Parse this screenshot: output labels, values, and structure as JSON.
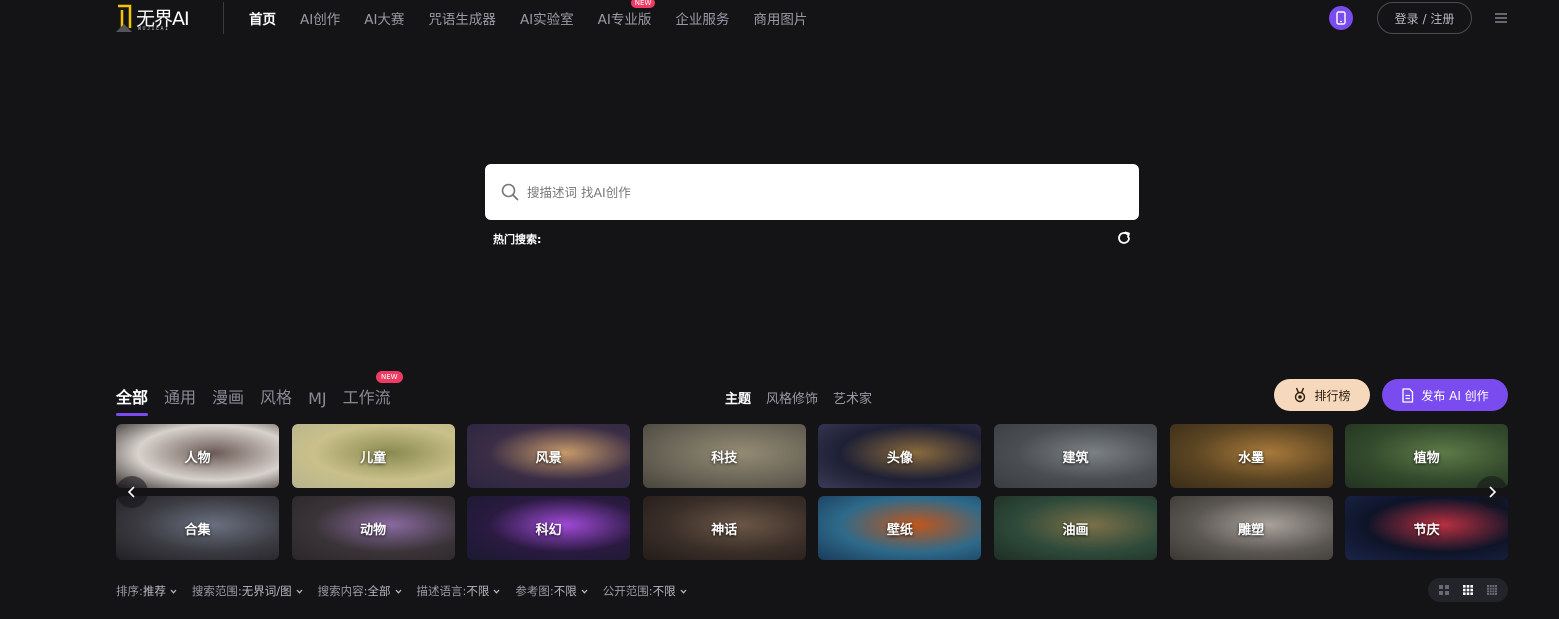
{
  "header": {
    "logo": {
      "text": "无界AI",
      "sub": "WUJIEAI"
    },
    "nav": [
      {
        "label": "首页",
        "active": true
      },
      {
        "label": "AI创作",
        "active": false
      },
      {
        "label": "AI大赛",
        "active": false
      },
      {
        "label": "咒语生成器",
        "active": false
      },
      {
        "label": "AI实验室",
        "active": false
      },
      {
        "label": "AI专业版",
        "active": false,
        "badge": "NEW"
      },
      {
        "label": "企业服务",
        "active": false
      },
      {
        "label": "商用图片",
        "active": false
      }
    ],
    "login_label": "登录 / 注册"
  },
  "search": {
    "placeholder": "搜描述词 找AI创作",
    "hot_label": "热门搜索:"
  },
  "category_tabs": [
    {
      "label": "全部",
      "active": true
    },
    {
      "label": "通用",
      "active": false
    },
    {
      "label": "漫画",
      "active": false
    },
    {
      "label": "风格",
      "active": false
    },
    {
      "label": "MJ",
      "active": false
    },
    {
      "label": "工作流",
      "active": false,
      "badge": "NEW"
    }
  ],
  "sub_tabs": [
    {
      "label": "主题",
      "active": true
    },
    {
      "label": "风格修饰",
      "active": false
    },
    {
      "label": "艺术家",
      "active": false
    }
  ],
  "actions": {
    "rank_label": "排行榜",
    "publish_label": "发布 AI 创作"
  },
  "themes": [
    {
      "label": "人物",
      "colors": [
        "#d8d2cc",
        "#6b5a55",
        "#2c2628"
      ]
    },
    {
      "label": "儿童",
      "colors": [
        "#c9c08a",
        "#8a8a50",
        "#b7b38d"
      ]
    },
    {
      "label": "风景",
      "colors": [
        "#3a2d45",
        "#c79a6a",
        "#2b2540"
      ]
    },
    {
      "label": "科技",
      "colors": [
        "#6b6658",
        "#948b73",
        "#4a453c"
      ]
    },
    {
      "label": "头像",
      "colors": [
        "#1e2035",
        "#8a6a3c",
        "#3a3a55"
      ]
    },
    {
      "label": "建筑",
      "colors": [
        "#4a4e52",
        "#7c8184",
        "#3a3e42"
      ]
    },
    {
      "label": "水墨",
      "colors": [
        "#5a4422",
        "#a8793b",
        "#3a2c18"
      ]
    },
    {
      "label": "植物",
      "colors": [
        "#334a2c",
        "#5e7a48",
        "#223320"
      ]
    },
    {
      "label": "合集",
      "colors": [
        "#3a3a40",
        "#6a7080",
        "#202024"
      ]
    },
    {
      "label": "动物",
      "colors": [
        "#3a3438",
        "#8a6aa0",
        "#2a262a"
      ]
    },
    {
      "label": "科幻",
      "colors": [
        "#2a1a40",
        "#a04ad8",
        "#1a1a30"
      ]
    },
    {
      "label": "神话",
      "colors": [
        "#3a2e28",
        "#6a5646",
        "#241c18"
      ]
    },
    {
      "label": "壁纸",
      "colors": [
        "#2e6a8a",
        "#c0561c",
        "#1a3a5a"
      ]
    },
    {
      "label": "油画",
      "colors": [
        "#2e4a3a",
        "#7a7048",
        "#1e2e24"
      ]
    },
    {
      "label": "雕塑",
      "colors": [
        "#5a5652",
        "#a8a29a",
        "#3a3632"
      ]
    },
    {
      "label": "节庆",
      "colors": [
        "#0e1428",
        "#b83040",
        "#1a2448"
      ]
    }
  ],
  "filters": [
    {
      "label": "排序:",
      "value": "推荐"
    },
    {
      "label": "搜索范围:",
      "value": "无界词/图"
    },
    {
      "label": "搜索内容:",
      "value": "全部"
    },
    {
      "label": "描述语言:",
      "value": "不限"
    },
    {
      "label": "参考图:",
      "value": "不限"
    },
    {
      "label": "公开范围:",
      "value": "不限"
    }
  ],
  "icons": {
    "search": "search-icon",
    "refresh": "refresh-icon",
    "phone": "phone-icon",
    "menu": "menu-icon",
    "medal": "medal-icon",
    "document": "document-icon"
  },
  "colors": {
    "accent": "#7a4cf0",
    "badge": "#ef3b63",
    "rank": "#f6d8bc",
    "background": "#141417"
  }
}
